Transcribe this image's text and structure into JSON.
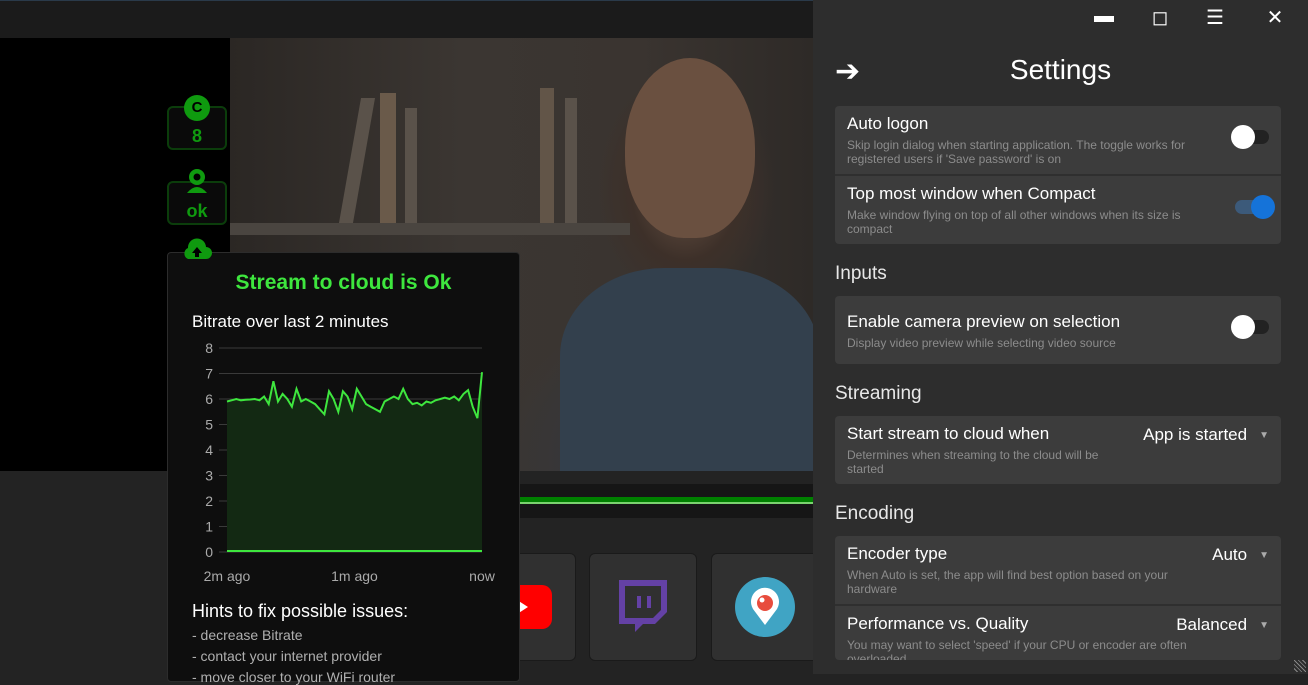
{
  "window": {
    "minimize": "minimize",
    "maximize": "maximize",
    "menu": "menu",
    "close": "close"
  },
  "badges": [
    {
      "icon": "C",
      "value": "8"
    },
    {
      "icon": "webcam",
      "value": "ok"
    }
  ],
  "popup": {
    "title": "Stream to cloud is Ok",
    "chart_title": "Bitrate over last 2 minutes",
    "hints_title": "Hints to fix possible issues:",
    "hints": [
      "- decrease Bitrate",
      "- contact your internet provider",
      "- move closer to your WiFi router"
    ]
  },
  "chart_data": {
    "type": "area",
    "title": "Bitrate over last 2 minutes",
    "xlabel": "",
    "ylabel": "",
    "ylim": [
      0,
      8
    ],
    "yticks": [
      "0",
      "1",
      "2",
      "3",
      "4",
      "5",
      "6",
      "7",
      "8"
    ],
    "xticks": [
      "2m ago",
      "1m ago",
      "now"
    ],
    "color": "#3ee63e",
    "values": [
      5.9,
      5.95,
      6.0,
      5.95,
      5.97,
      5.98,
      6.0,
      5.95,
      6.1,
      5.8,
      6.7,
      5.9,
      6.2,
      6.0,
      5.7,
      6.4,
      5.9,
      6.0,
      5.9,
      5.8,
      5.6,
      5.4,
      6.3,
      6.0,
      5.5,
      6.3,
      6.1,
      5.6,
      6.4,
      6.1,
      5.8,
      5.7,
      5.6,
      5.5,
      5.9,
      6.0,
      6.1,
      6.0,
      6.4,
      6.0,
      5.8,
      5.85,
      5.75,
      5.9,
      5.85,
      5.95,
      6.0,
      6.05,
      6.0,
      6.1,
      5.95,
      6.2,
      6.35,
      5.7,
      5.25,
      7.05
    ]
  },
  "settings": {
    "title": "Settings",
    "general": [
      {
        "title": "Auto logon",
        "desc": "Skip login dialog when starting application. The toggle works for registered users if 'Save password' is on",
        "on": false
      },
      {
        "title": "Top most window when Compact",
        "desc": "Make window flying on top of all other windows when its size is compact",
        "on": true
      }
    ],
    "inputs_header": "Inputs",
    "inputs": [
      {
        "title": "Enable camera preview on selection",
        "desc": "Display video preview while selecting video source",
        "on": false
      }
    ],
    "streaming_header": "Streaming",
    "streaming": [
      {
        "title": "Start stream to cloud when",
        "desc": "Determines when streaming to the cloud will be started",
        "value": "App is started"
      }
    ],
    "encoding_header": "Encoding",
    "encoding": [
      {
        "title": "Encoder type",
        "desc": "When Auto is set, the app will find best option based on your hardware",
        "value": "Auto"
      },
      {
        "title": "Performance vs. Quality",
        "desc": "You may want to select 'speed' if your CPU or encoder are often overloaded",
        "value": "Balanced"
      }
    ]
  },
  "colors": {
    "accent": "#3ee63e",
    "toggle_on": "#1573d9",
    "twitch": "#6441a5",
    "youtube": "#ff0000",
    "periscope": "#40a4c4"
  }
}
